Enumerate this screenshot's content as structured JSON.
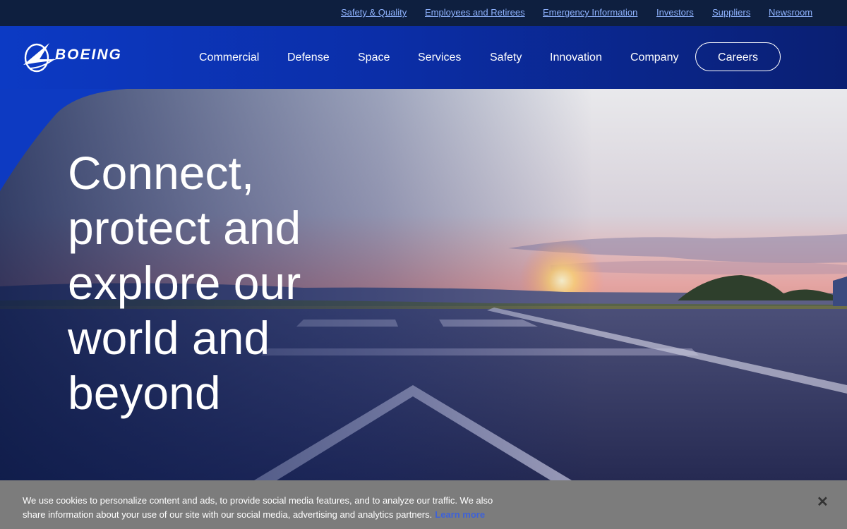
{
  "utility_nav": [
    {
      "label": "Safety & Quality"
    },
    {
      "label": "Employees and Retirees"
    },
    {
      "label": "Emergency Information"
    },
    {
      "label": "Investors"
    },
    {
      "label": "Suppliers"
    },
    {
      "label": "Newsroom"
    }
  ],
  "brand": {
    "name": "BOEING",
    "logo_icon": "boeing-symbol"
  },
  "main_nav": [
    {
      "label": "Commercial"
    },
    {
      "label": "Defense"
    },
    {
      "label": "Space"
    },
    {
      "label": "Services"
    },
    {
      "label": "Safety"
    },
    {
      "label": "Innovation"
    },
    {
      "label": "Company"
    }
  ],
  "careers_label": "Careers",
  "hero": {
    "headline": "Connect, protect and explore our world and beyond",
    "image": "runway-at-sunset"
  },
  "cookie": {
    "text": "We use cookies to personalize content and ads, to provide social media features, and to analyze our traffic. We also share information about your use of our site with our social media, advertising and analytics partners.",
    "link": "Learn more",
    "close_icon": "close-icon"
  },
  "colors": {
    "brand_blue": "#0c3ac4",
    "utility_bg": "#0e1f3f",
    "link_blue": "#8fb3ff"
  }
}
